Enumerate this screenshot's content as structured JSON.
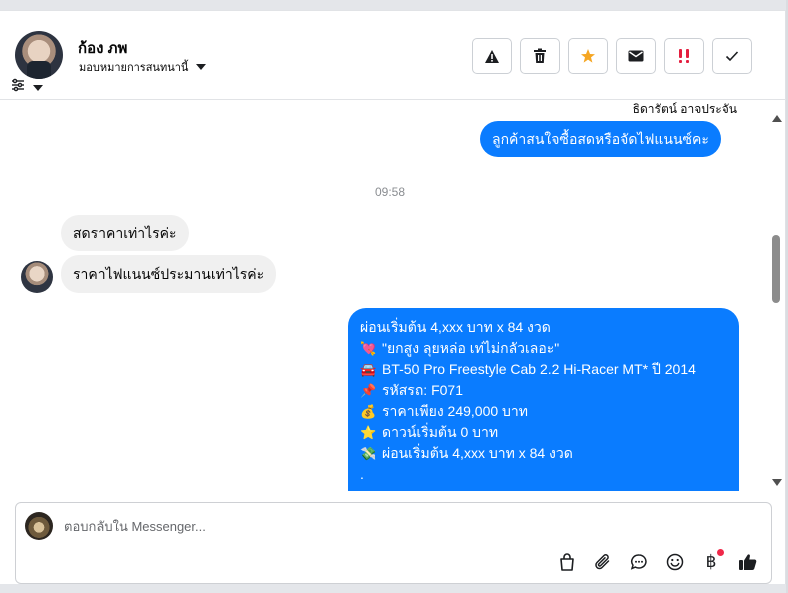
{
  "header": {
    "contact_name": "ก้อง ภพ",
    "assign_label": "มอบหมายการสนทนานี้"
  },
  "actions": [
    {
      "name": "report-button",
      "icon": "warning-icon"
    },
    {
      "name": "delete-button",
      "icon": "trash-icon"
    },
    {
      "name": "star-button",
      "icon": "star-icon",
      "color": "#f5a623"
    },
    {
      "name": "mark-unread-button",
      "icon": "envelope-icon"
    },
    {
      "name": "follow-up-button",
      "icon": "exclamation-icon",
      "color": "#e41e3f"
    },
    {
      "name": "mark-done-button",
      "icon": "check-icon"
    }
  ],
  "messages": {
    "sender_name": "ธิดารัตน์ อาจประจัน",
    "outgoing_1": "ลูกค้าสนใจซื้อสดหรือจัดไฟแนนซ์คะ",
    "timestamp": "09:58",
    "incoming_1": "สดราคาเท่าไรค่ะ",
    "incoming_2": "ราคาไฟแนนซ์ประมานเท่าไรค่ะ",
    "outgoing_2": {
      "line_1": "ผ่อนเริ่มต้น 4,xxx บาท x 84 งวด",
      "line_2": "\"ยกสูง ลุยหล่อ เท่ไม่กลัวเลอะ\"",
      "line_3": "BT-50 Pro Freestyle Cab 2.2 Hi-Racer MT* ปี 2014",
      "line_4": "รหัสรถ: F071",
      "line_5": "ราคาเพียง 249,000 บาท",
      "line_6": "ดาวน์เริ่มต้น 0 บาท",
      "line_7": "ผ่อนเริ่มต้น 4,xxx บาท x 84 งวด",
      "line_8": "."
    },
    "emojis": {
      "line_2": "💘",
      "line_3": "🚘",
      "line_4": "📌",
      "line_5": "💰",
      "line_6": "⭐",
      "line_7": "💸"
    }
  },
  "composer": {
    "placeholder": "ตอบกลับใน Messenger...",
    "tools": [
      "shopping-bag-icon",
      "paperclip-icon",
      "saved-reply-icon",
      "emoji-icon",
      "baht-payment-icon",
      "thumbs-up-icon"
    ],
    "baht_symbol": "฿"
  },
  "colors": {
    "outgoing_bubble": "#0a7cff",
    "incoming_bubble": "#f0f0f0",
    "star": "#f5a623",
    "alert": "#e41e3f"
  }
}
